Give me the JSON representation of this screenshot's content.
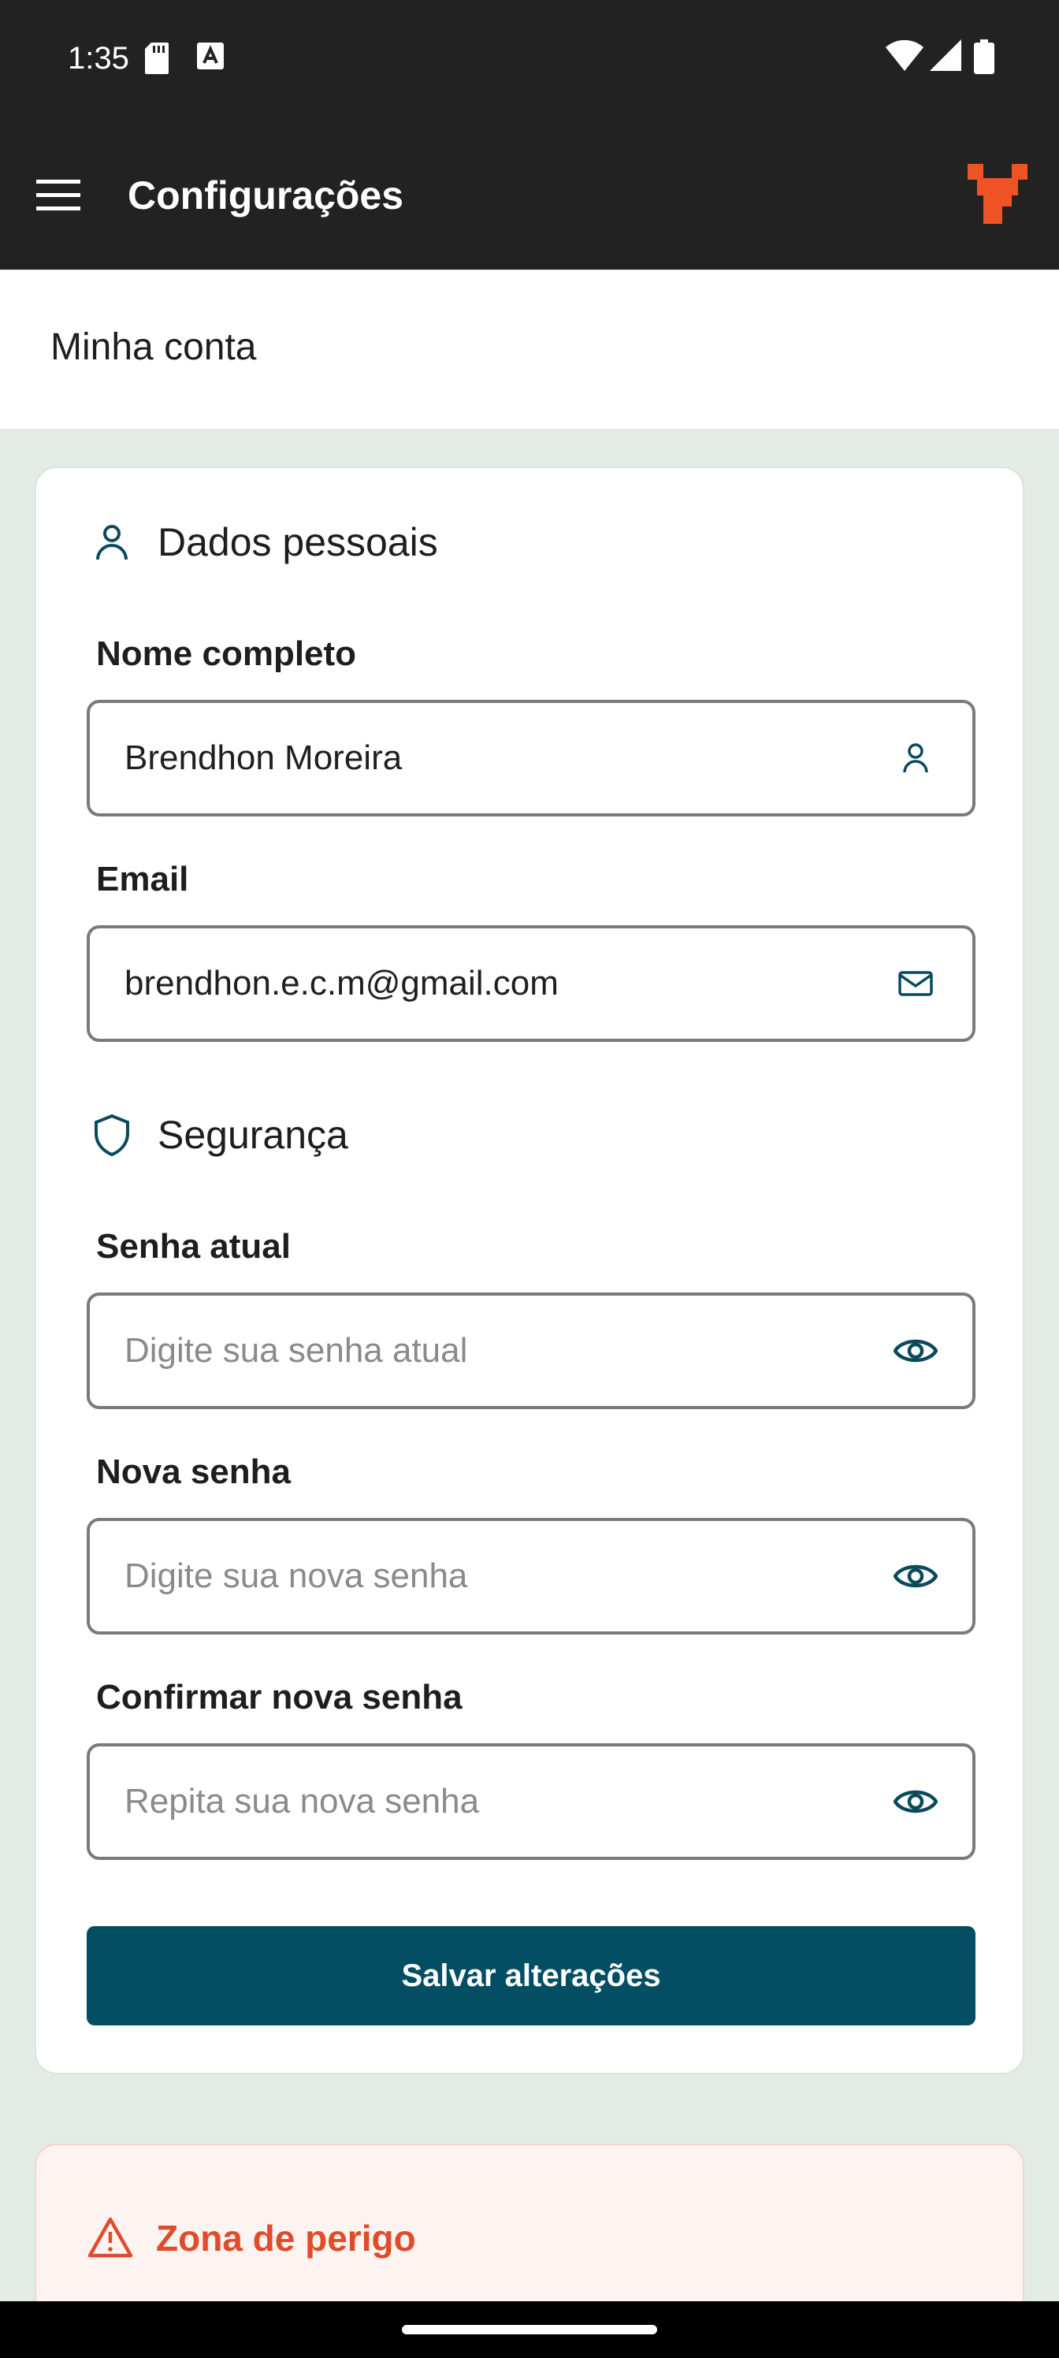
{
  "status_bar": {
    "time": "1:35",
    "icons": [
      "sd-card-icon",
      "keyboard-a-icon",
      "wifi-icon",
      "signal-icon",
      "battery-icon"
    ]
  },
  "app_bar": {
    "title": "Configurações",
    "menu_icon": "hamburger-menu-icon",
    "logo_icon": "app-logo-icon",
    "logo_color": "#f05323"
  },
  "subheader": {
    "title": "Minha conta"
  },
  "personal": {
    "title": "Dados pessoais",
    "icon": "user-icon",
    "name_label": "Nome completo",
    "name_value": "Brendhon Moreira",
    "email_label": "Email",
    "email_value": "brendhon.e.c.m@gmail.com"
  },
  "security": {
    "title": "Segurança",
    "icon": "shield-icon",
    "current_label": "Senha atual",
    "current_placeholder": "Digite sua senha atual",
    "new_label": "Nova senha",
    "new_placeholder": "Digite sua nova senha",
    "confirm_label": "Confirmar nova senha",
    "confirm_placeholder": "Repita sua nova senha"
  },
  "save_button": {
    "label": "Salvar alterações"
  },
  "danger_zone": {
    "title": "Zona de perigo",
    "icon": "warning-triangle-icon"
  },
  "colors": {
    "accent": "#044e63",
    "danger": "#e04b2b",
    "background": "#e2ece4"
  }
}
